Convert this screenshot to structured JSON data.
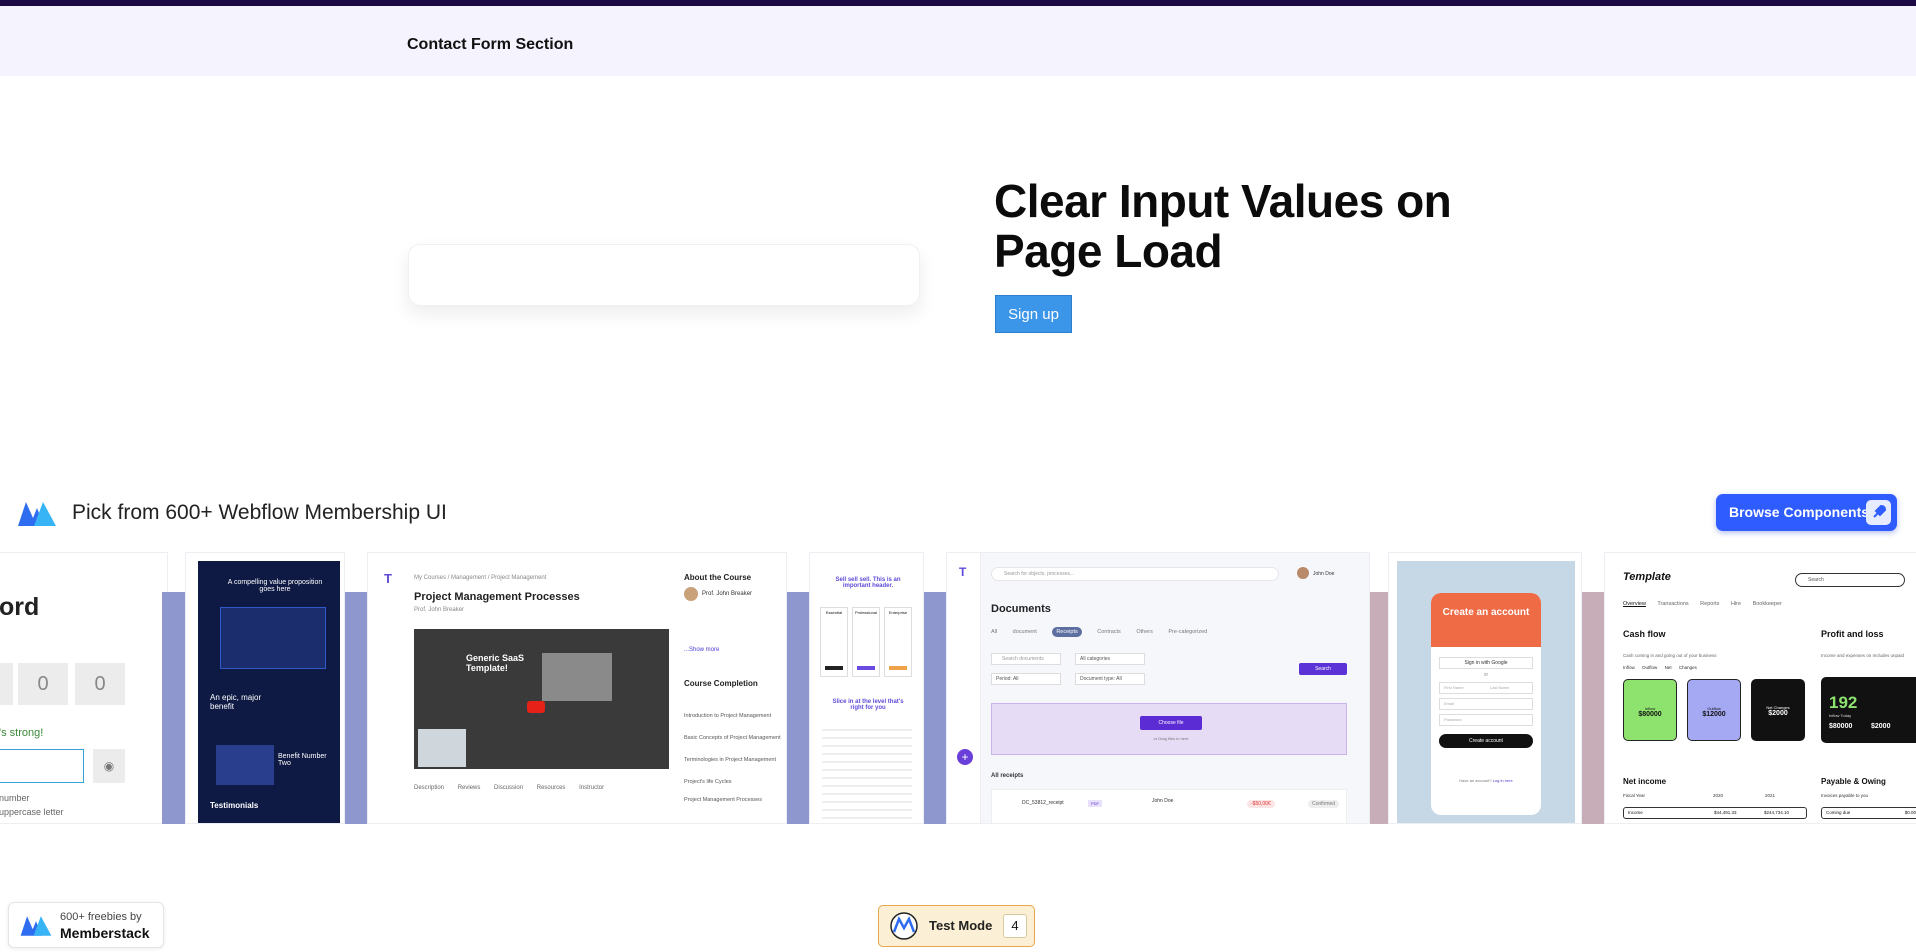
{
  "header": {
    "title": "Contact Form Section"
  },
  "hero": {
    "title": "Clear Input Values on Page Load",
    "signup_label": "Sign up"
  },
  "promo": {
    "text": "Pick from 600+ Webflow Membership UI",
    "browse_label": "Browse Components"
  },
  "previews": {
    "password": {
      "title_fragment": "ord",
      "codes": [
        "0",
        "0",
        "0"
      ],
      "strength": "'s strong!",
      "rule1": "number",
      "rule2": "uppercase letter"
    },
    "saas": {
      "headline": "A compelling value proposition goes here",
      "epic": "An epic, major benefit",
      "benefit2": "Benefit Number Two",
      "testimonials": "Testimonials"
    },
    "course": {
      "breadcrumb": [
        "My Courses",
        "Management",
        "Project Management"
      ],
      "title": "Project Management Processes",
      "author": "Prof. John Breaker",
      "video_title": "Generic SaaS Template!",
      "tabs": [
        "Description",
        "Reviews",
        "Discussion",
        "Resources",
        "Instructor"
      ],
      "about_title": "About the Course",
      "completion_title": "Course Completion",
      "lessons": [
        "Introduction to Project Management",
        "Basic Concepts of Project Management",
        "Terminologies in Project Management",
        "Project's life Cycles",
        "Project Management Processes"
      ],
      "show_more": "...Show more"
    },
    "pricing": {
      "headline": "Sell sell sell. This is an important header.",
      "sub": "Slice in at the level that's right for you",
      "plans": [
        "Essential",
        "Professional",
        "Enterprise"
      ]
    },
    "docs": {
      "search_placeholder": "Search for objects, processes...",
      "user": "John Doe",
      "title": "Documents",
      "tabs": [
        "All document",
        "Receipts",
        "Contracts",
        "Others",
        "Pre-categorized"
      ],
      "search_documents": "Search documents",
      "all_categories": "All categories",
      "period": "Period: All",
      "doc_type": "Document type: All",
      "search_btn": "Search",
      "choose_file": "Choose file",
      "drop_text": "or Drag files in here",
      "all_receipts": "All receipts",
      "receipt_name": "DC_53812_receipt",
      "receipt_badge": "PDF",
      "receipt_owner": "John Doe",
      "receipt_amount": "-$50,00€",
      "receipt_status": "Confirmed"
    },
    "account": {
      "title": "Create an account",
      "google": "Sign in with Google",
      "or": "or",
      "first": "First Name",
      "last": "Last Name",
      "email": "Email",
      "password": "Password",
      "create": "Create account",
      "have": "Have an account?",
      "login": "Log in here"
    },
    "finance": {
      "brand": "Template",
      "search": "Search",
      "tabs": [
        "Overview",
        "Transactions",
        "Reports",
        "Hire Bookkeeper"
      ],
      "cash_flow": "Cash flow",
      "cash_sub": "Cash coming in and going out of your business",
      "legend": [
        "Inflow",
        "Outflow",
        "Net Changes"
      ],
      "cards": [
        {
          "label": "Inflow",
          "value": "$80000"
        },
        {
          "label": "Outflow",
          "value": "$12000"
        },
        {
          "label": "Net Changes",
          "value": "$2000"
        }
      ],
      "profit_loss": "Profit and loss",
      "profit_sub": "Income and expenses on Includes unpaid",
      "big_value": "192",
      "big_label": "Inflow Today",
      "pl_values": [
        "$80000",
        "$2000"
      ],
      "pl_labels": [
        "Inflow",
        "Outflow"
      ],
      "net_income": "Net income",
      "fiscal": "Fiscal Year",
      "years": [
        "2020",
        "2021"
      ],
      "income": "Income",
      "income_values": [
        "$44,491.33",
        "$244,734.10"
      ],
      "payable": "Payable & Owing",
      "invoices": "Invoices payable to you",
      "coming_due": "Coming due",
      "due_value": "$0.00"
    }
  },
  "footer": {
    "freebies": "600+ freebies by",
    "brand": "Memberstack",
    "test_mode": "Test Mode",
    "test_count": "4"
  },
  "colors": {
    "topbar": "#1c0a45",
    "header_bg": "#f4f3fe",
    "signup": "#3b95e8",
    "browse": "#2f5cff",
    "test_mode_bg": "#fbefd5"
  }
}
